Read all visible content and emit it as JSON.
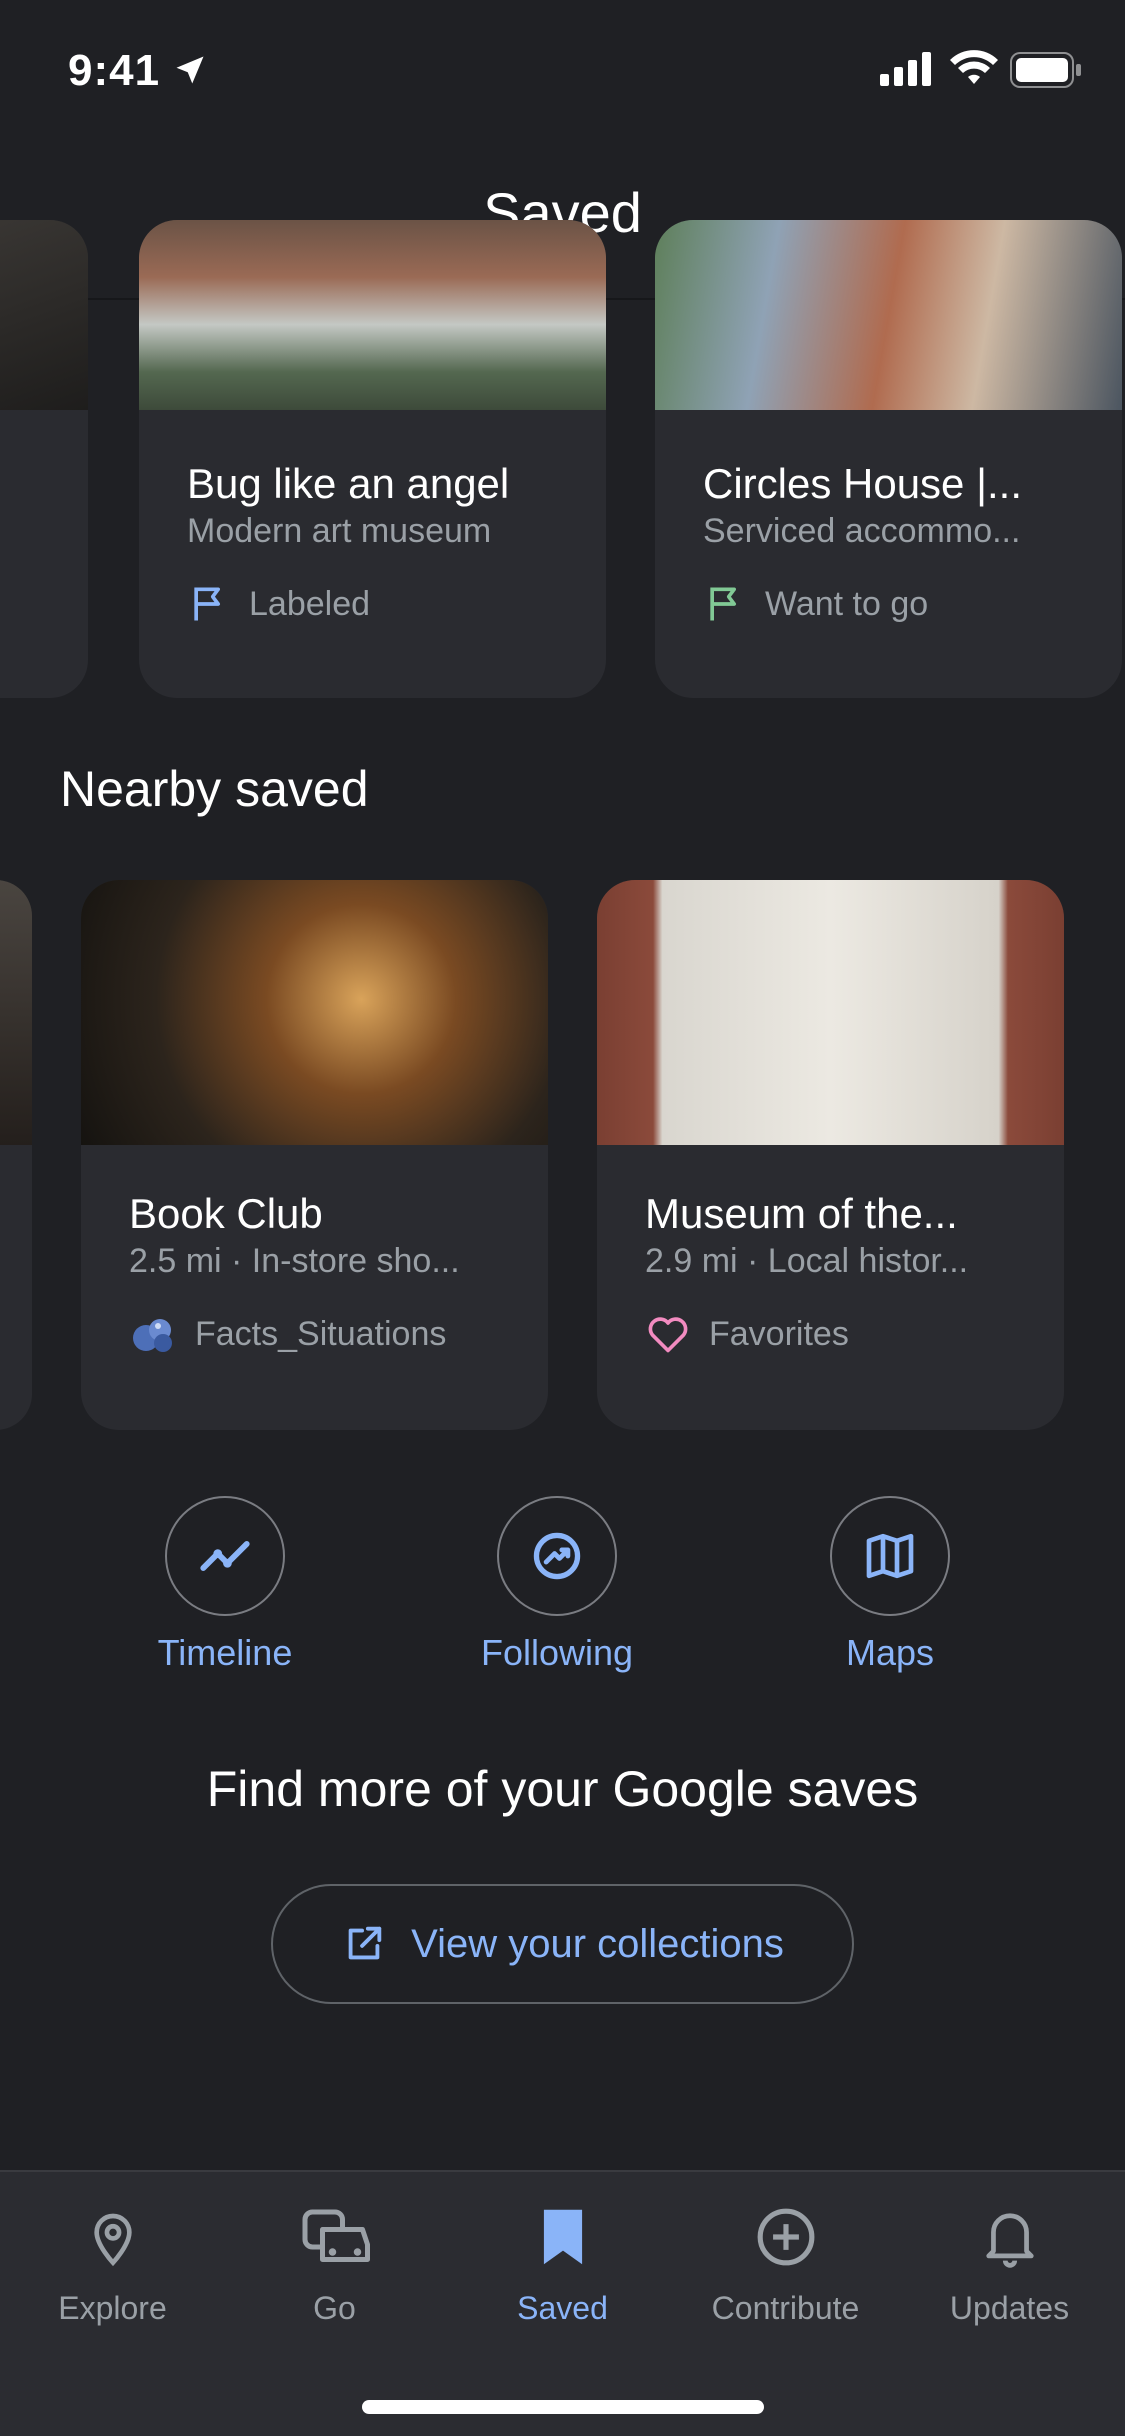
{
  "status": {
    "time": "9:41"
  },
  "header": {
    "title": "Saved"
  },
  "top_cards": [
    {
      "name": "Bug like an angel",
      "sub": "Modern art museum",
      "tag": "Labeled",
      "tag_icon": "flag-outline-icon"
    },
    {
      "name": "Circles House |...",
      "sub": "Serviced accommo...",
      "tag": "Want to go",
      "tag_icon": "flag-green-icon"
    }
  ],
  "nearby": {
    "title": "Nearby saved",
    "cards": [
      {
        "name": "Book Club",
        "sub": "2.5 mi · In-store sho...",
        "tag": "Facts_Situations",
        "tag_icon": "blueberry-icon"
      },
      {
        "name": "Museum of the...",
        "sub": "2.9 mi · Local histor...",
        "tag": "Favorites",
        "tag_icon": "heart-icon"
      }
    ]
  },
  "shortcuts": [
    {
      "label": "Timeline",
      "icon": "timeline-icon"
    },
    {
      "label": "Following",
      "icon": "following-icon"
    },
    {
      "label": "Maps",
      "icon": "map-icon"
    }
  ],
  "find_more": {
    "text": "Find more of your Google saves",
    "button": "View your collections"
  },
  "bottom_nav": [
    {
      "label": "Explore",
      "icon": "pin-icon"
    },
    {
      "label": "Go",
      "icon": "commute-icon"
    },
    {
      "label": "Saved",
      "icon": "bookmark-icon",
      "active": true
    },
    {
      "label": "Contribute",
      "icon": "add-circle-icon"
    },
    {
      "label": "Updates",
      "icon": "bell-icon"
    }
  ],
  "colors": {
    "accent": "#8ab4f8",
    "background": "#1f2024",
    "card": "#2a2b30",
    "green": "#81c995",
    "pink": "#f28bc0"
  }
}
